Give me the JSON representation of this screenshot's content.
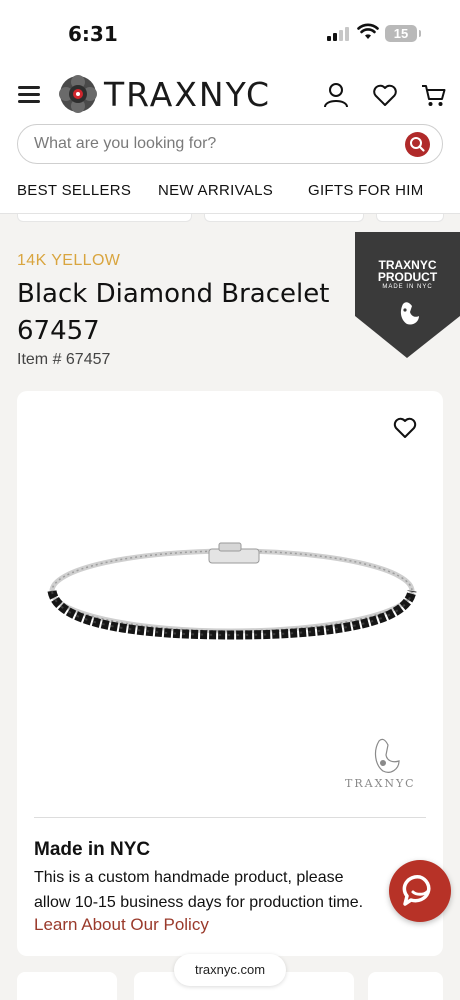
{
  "status": {
    "time": "6:31",
    "battery": "15"
  },
  "header": {
    "brand": "TRAXNYC",
    "search_placeholder": "What are you looking for?",
    "nav": [
      "BEST SELLERS",
      "NEW ARRIVALS",
      "GIFTS FOR HIM"
    ]
  },
  "product": {
    "metal": "14K YELLOW",
    "title_line1": "Black Diamond Bracelet",
    "title_line2": "67457",
    "item_number": "Item # 67457",
    "badge": {
      "line1": "TRAXNYC",
      "line2": "PRODUCT",
      "line3": "MADE IN NYC"
    },
    "watermark": "TRAXNYC"
  },
  "made_in_nyc": {
    "title": "Made in NYC",
    "line1": "This is a custom handmade product, please",
    "line2": "allow 10-15 business days for production time.",
    "link": "Learn About Our Policy"
  },
  "browser": {
    "url": "traxnyc.com"
  },
  "colors": {
    "accent": "#b02a2a",
    "gold": "#d9a53f",
    "badge": "#3a3a3a",
    "link": "#9a3a2b"
  }
}
